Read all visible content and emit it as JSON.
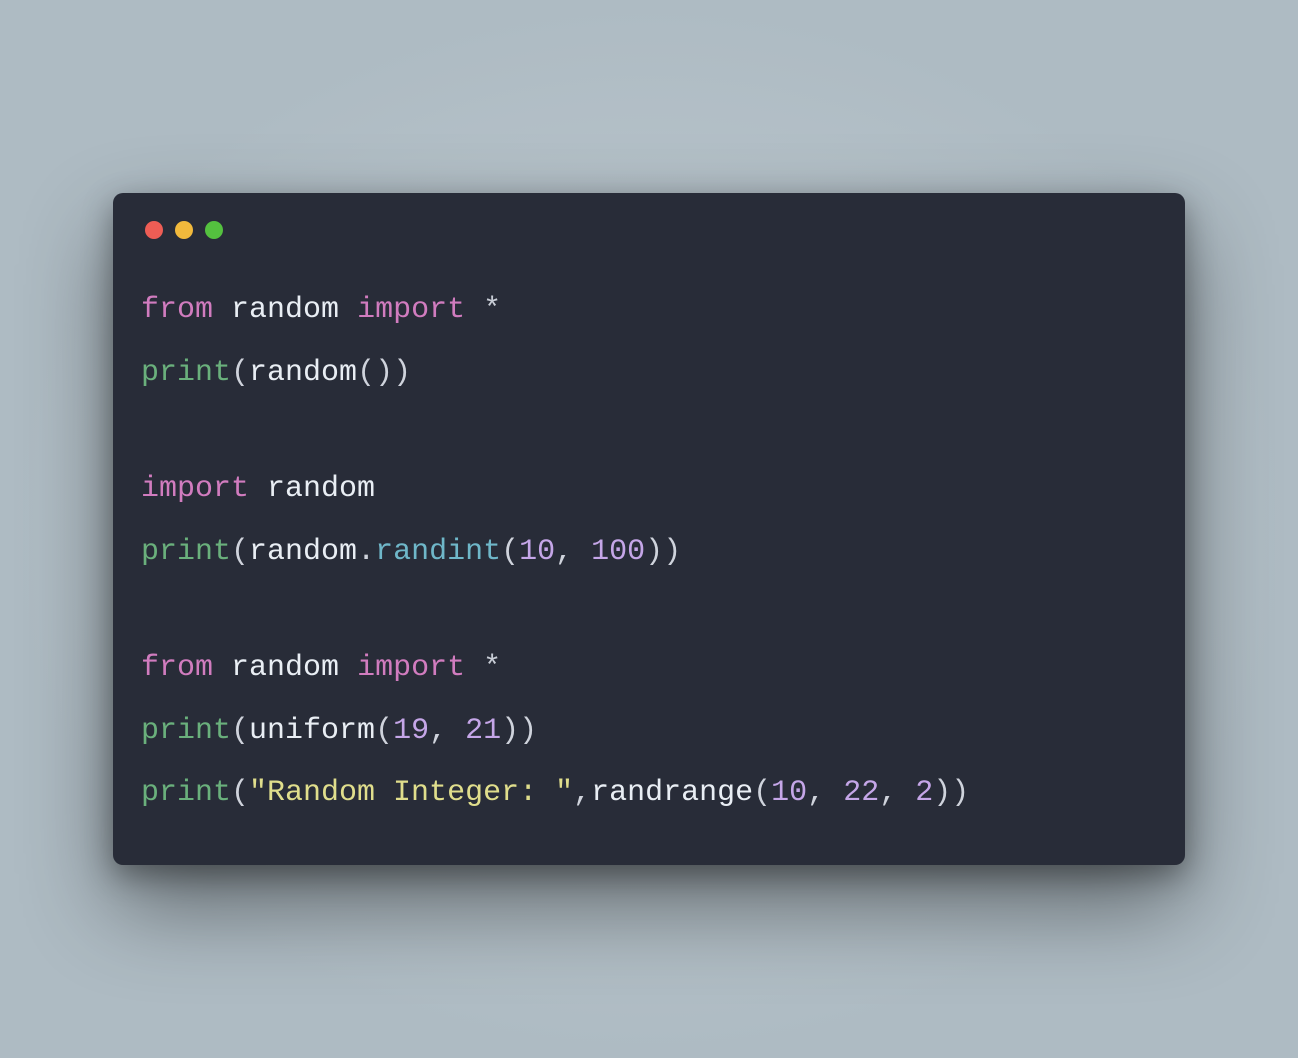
{
  "colors": {
    "background": "#aebbc3",
    "window": "#282c38",
    "red": "#ee5d55",
    "yellow": "#f1b93c",
    "green": "#54c13f",
    "keyword": "#d17cbf",
    "identifier": "#e9eef4",
    "function": "#6ab07c",
    "method": "#6fb7c9",
    "number": "#c5a6e8",
    "string": "#e0de8c",
    "punct": "#cfd3dc"
  },
  "code": {
    "block1": {
      "line1": {
        "from": "from",
        "module": "random",
        "import": "import",
        "star": "*"
      },
      "line2": {
        "print": "print",
        "lp": "(",
        "call": "random",
        "inner_lp": "(",
        "inner_rp": ")",
        "rp": ")"
      }
    },
    "block2": {
      "line1": {
        "import": "import",
        "module": "random"
      },
      "line2": {
        "print": "print",
        "lp": "(",
        "obj": "random",
        "dot": ".",
        "method": "randint",
        "inner_lp": "(",
        "arg1": "10",
        "comma": ", ",
        "arg2": "100",
        "inner_rp": ")",
        "rp": ")"
      }
    },
    "block3": {
      "line1": {
        "from": "from",
        "module": "random",
        "import": "import",
        "star": "*"
      },
      "line2": {
        "print": "print",
        "lp": "(",
        "call": "uniform",
        "inner_lp": "(",
        "arg1": "19",
        "comma": ", ",
        "arg2": "21",
        "inner_rp": ")",
        "rp": ")"
      },
      "line3": {
        "print": "print",
        "lp": "(",
        "str": "\"Random Integer: \"",
        "comma1": ",",
        "call": "randrange",
        "inner_lp": "(",
        "arg1": "10",
        "comma2": ", ",
        "arg2": "22",
        "comma3": ", ",
        "arg3": "2",
        "inner_rp": ")",
        "rp": ")"
      }
    }
  }
}
